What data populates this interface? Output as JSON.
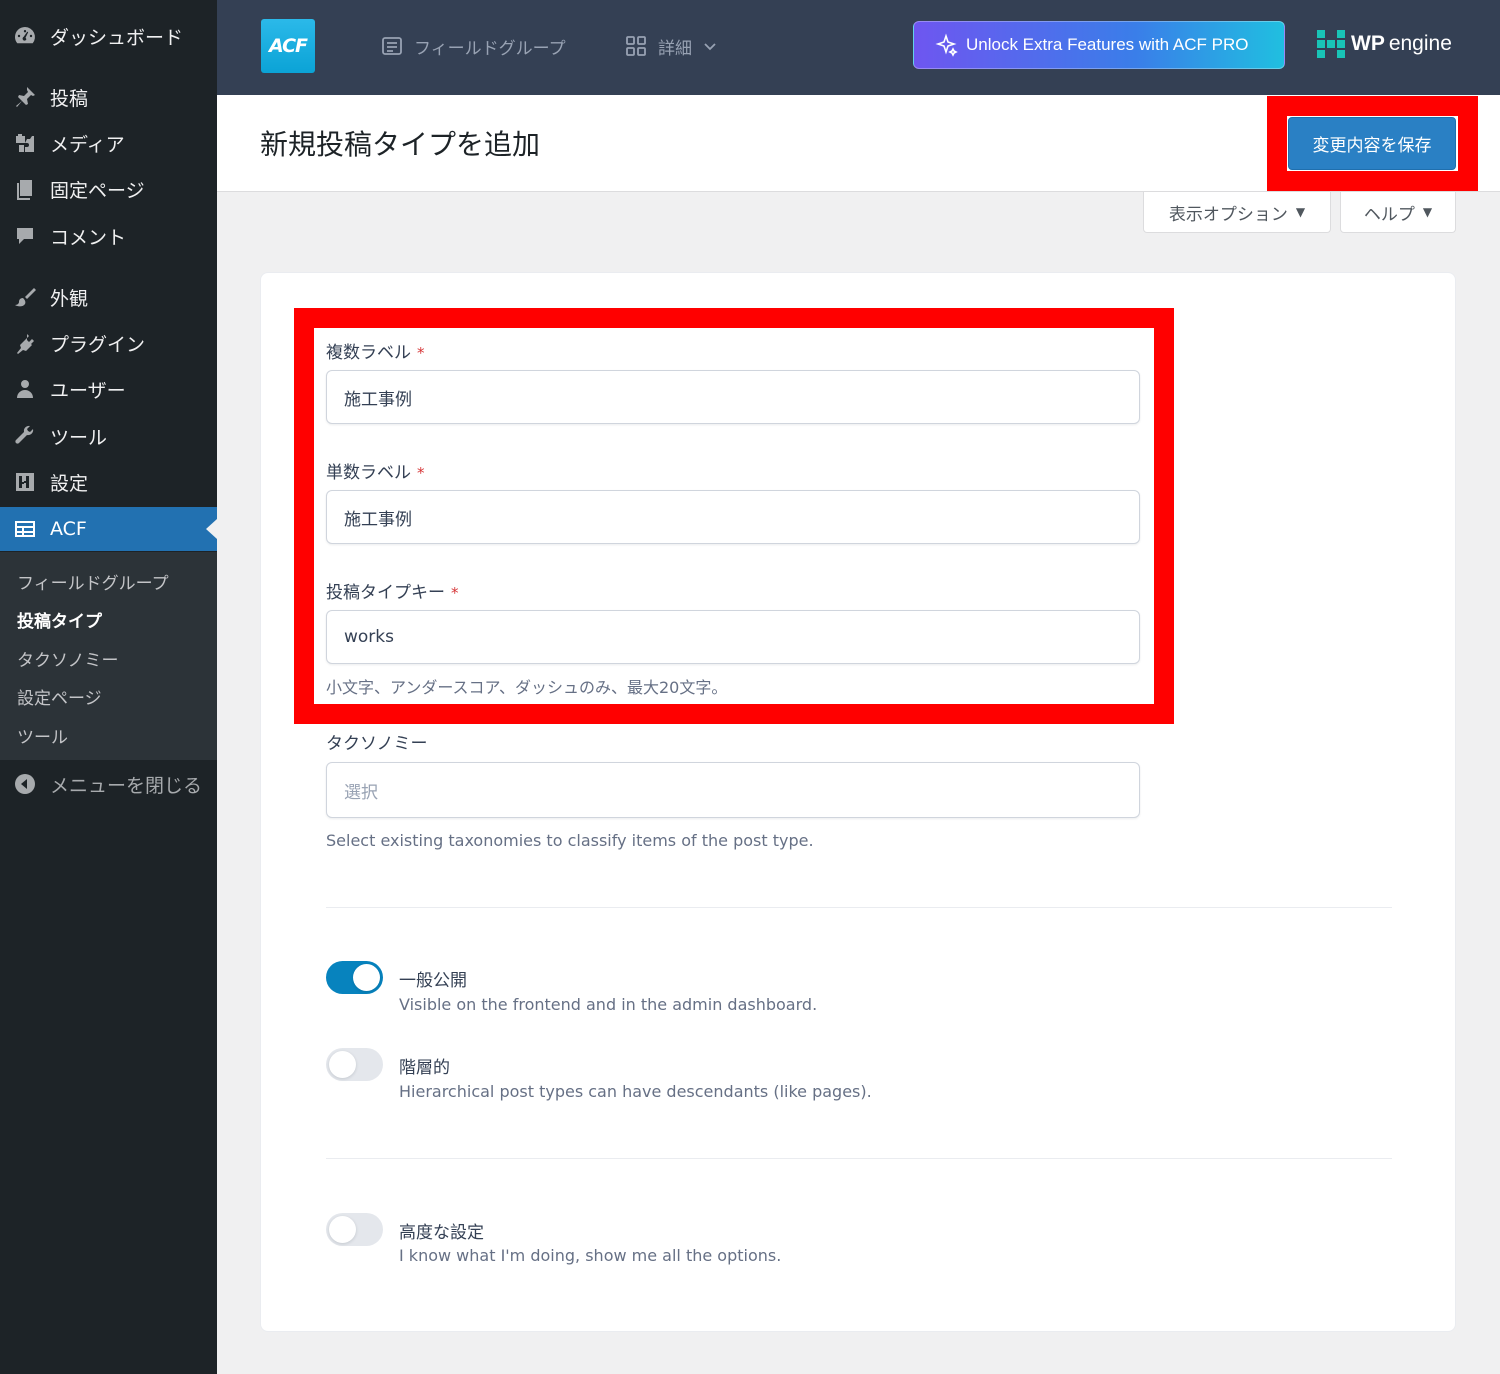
{
  "sidebar": {
    "items": [
      {
        "label": "ダッシュボード",
        "icon": "dashboard-icon"
      },
      {
        "label": "投稿",
        "icon": "pin-icon"
      },
      {
        "label": "メディア",
        "icon": "media-icon"
      },
      {
        "label": "固定ページ",
        "icon": "pages-icon"
      },
      {
        "label": "コメント",
        "icon": "comment-icon"
      },
      {
        "label": "外観",
        "icon": "appearance-icon"
      },
      {
        "label": "プラグイン",
        "icon": "plugin-icon"
      },
      {
        "label": "ユーザー",
        "icon": "user-icon"
      },
      {
        "label": "ツール",
        "icon": "wrench-icon"
      },
      {
        "label": "設定",
        "icon": "settings-icon"
      },
      {
        "label": "ACF",
        "icon": "acf-icon"
      }
    ],
    "submenu": [
      "フィールドグループ",
      "投稿タイプ",
      "タクソノミー",
      "設定ページ",
      "ツール"
    ],
    "collapse_label": "メニューを閉じる"
  },
  "header": {
    "logo_text": "ACF",
    "nav_field_groups": "フィールドグループ",
    "nav_more": "詳細",
    "pro_button": "Unlock Extra Features with ACF PRO",
    "partner_bold": "WP",
    "partner_rest": "engine"
  },
  "titlebar": {
    "title": "新規投稿タイプを追加",
    "save_button": "変更内容を保存"
  },
  "screen": {
    "options": "表示オプション",
    "help": "ヘルプ"
  },
  "form": {
    "plural_label": "複数ラベル",
    "plural_value": "施工事例",
    "singular_label": "単数ラベル",
    "singular_value": "施工事例",
    "key_label": "投稿タイプキー",
    "key_value": "works",
    "key_help": "小文字、アンダースコア、ダッシュのみ、最大20文字。",
    "required_mark": "*",
    "taxonomy_label": "タクソノミー",
    "taxonomy_placeholder": "選択",
    "taxonomy_help": "Select existing taxonomies to classify items of the post type.",
    "public_label": "一般公開",
    "public_desc": "Visible on the frontend and in the admin dashboard.",
    "public_on": true,
    "hier_label": "階層的",
    "hier_desc": "Hierarchical post types can have descendants (like pages).",
    "hier_on": false,
    "adv_label": "高度な設定",
    "adv_desc": "I know what I'm doing, show me all the options.",
    "adv_on": false
  },
  "colors": {
    "highlight": "#ff0000",
    "primary": "#2271b1",
    "toggle_on": "#0783be"
  }
}
